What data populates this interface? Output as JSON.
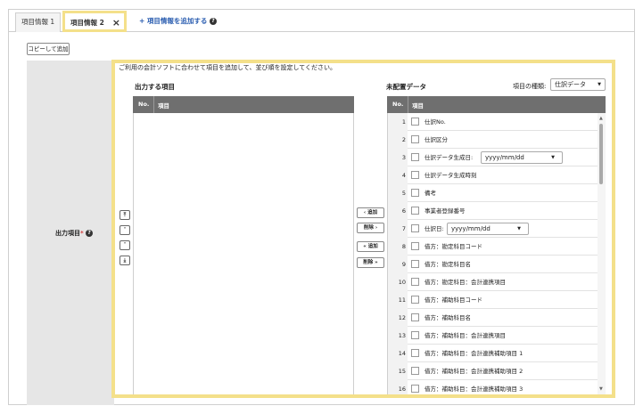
{
  "tabs": {
    "tab1_label": "項目情報 1",
    "tab2_label": "項目情報 2",
    "tab2_close": "×",
    "add_tab_label": "+ 項目情報を追加する"
  },
  "copy_button": "コピーして追加",
  "field": {
    "label": "出力項目",
    "required_mark": "*"
  },
  "description": "ご利用の会計ソフトに合わせて項目を追加して、並び順を設定してください。",
  "output_section": {
    "title": "出力する項目",
    "col_no": "No.",
    "col_item": "項目"
  },
  "unplaced_section": {
    "title": "未配置データ",
    "kind_label": "項目の種類:",
    "kind_value": "仕訳データ",
    "col_no": "No.",
    "col_item": "項目"
  },
  "order_buttons": {
    "top": "⤒",
    "up": "˄",
    "down": "˅",
    "bottom": "⤓"
  },
  "move_buttons": {
    "add": "‹ 追加",
    "remove": "削除 ›",
    "add_all": "« 追加",
    "remove_all": "削除 »"
  },
  "rows": [
    {
      "no": "1",
      "text": "仕訳No."
    },
    {
      "no": "2",
      "text": "仕訳区分"
    },
    {
      "no": "3",
      "text": "仕訳データ生成日:",
      "select": "yyyy/mm/dd"
    },
    {
      "no": "4",
      "text": "仕訳データ生成時刻"
    },
    {
      "no": "5",
      "text": "備考"
    },
    {
      "no": "6",
      "text": "事業者登録番号"
    },
    {
      "no": "7",
      "text": "仕訳日:",
      "select": "yyyy/mm/dd"
    },
    {
      "no": "8",
      "text": "借方：勘定科目コード"
    },
    {
      "no": "9",
      "text": "借方：勘定科目名"
    },
    {
      "no": "10",
      "text": "借方：勘定科目：会計連携項目"
    },
    {
      "no": "11",
      "text": "借方：補助科目コード"
    },
    {
      "no": "12",
      "text": "借方：補助科目名"
    },
    {
      "no": "13",
      "text": "借方：補助科目：会計連携項目"
    },
    {
      "no": "14",
      "text": "借方：補助科目：会計連携補助項目 1"
    },
    {
      "no": "15",
      "text": "借方：補助科目：会計連携補助項目 2"
    },
    {
      "no": "16",
      "text": "借方：補助科目：会計連携補助項目 3"
    }
  ],
  "icons": {
    "help": "question-circle-icon",
    "select_arrow": "chevron-down-icon"
  },
  "colors": {
    "highlight": "#f4e08a",
    "table_header": "#6f6f6f",
    "link": "#2a5db0",
    "required": "#d23c3c"
  }
}
